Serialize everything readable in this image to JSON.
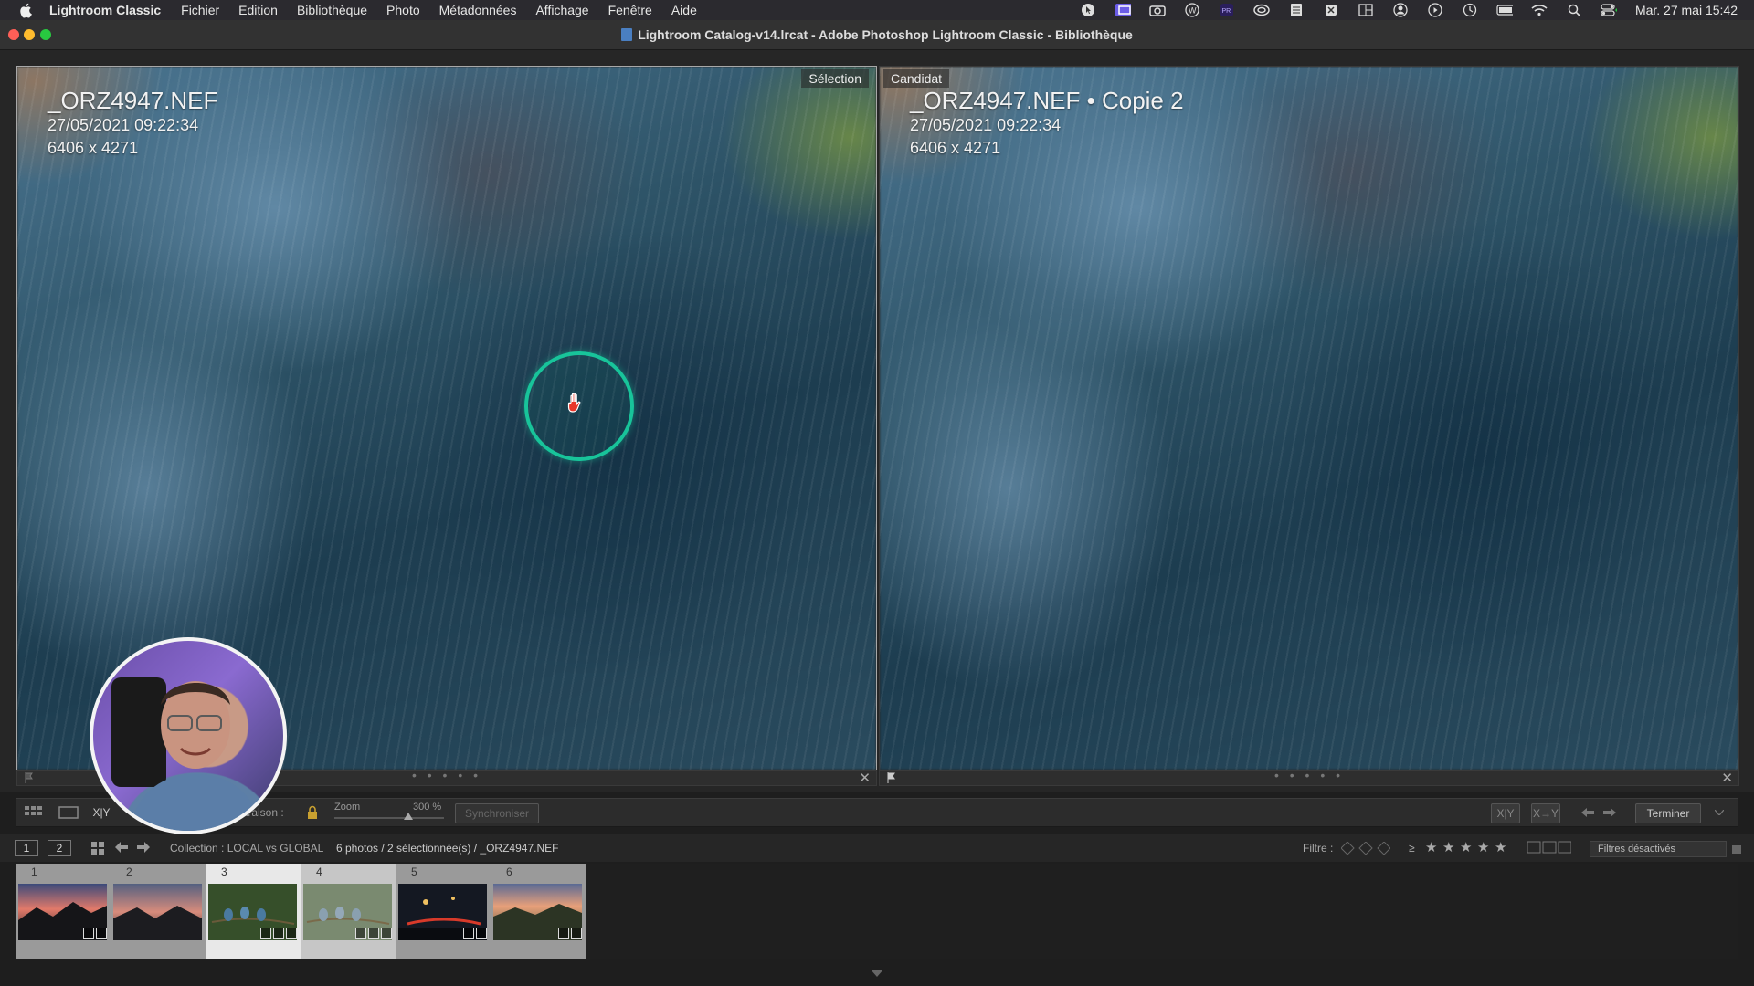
{
  "menubar": {
    "app_name": "Lightroom Classic",
    "items": [
      "Fichier",
      "Edition",
      "Bibliothèque",
      "Photo",
      "Métadonnées",
      "Affichage",
      "Fenêtre",
      "Aide"
    ],
    "clock": "Mar. 27 mai  15:42"
  },
  "window": {
    "title": "Lightroom Catalog-v14.lrcat - Adobe Photoshop Lightroom Classic - Bibliothèque"
  },
  "left_pane": {
    "label": "Sélection",
    "filename": "_ORZ4947.NEF",
    "datetime": "27/05/2021 09:22:34",
    "dimensions": "6406 x 4271"
  },
  "right_pane": {
    "label": "Candidat",
    "filename": "_ORZ4947.NEF  •  Copie 2",
    "datetime": "27/05/2021 09:22:34",
    "dimensions": "6406 x 4271"
  },
  "strip": {
    "dots": "• • • • •",
    "close": "✕"
  },
  "toolbar": {
    "compare_label": "paraison :",
    "zoom_label": "Zoom",
    "zoom_value": "300 %",
    "sync_label": "Synchroniser",
    "xy1": "X|Y",
    "xy2": "X→Y",
    "done_label": "Terminer"
  },
  "filmstrip_bar": {
    "page1": "1",
    "page2": "2",
    "collection": "Collection : LOCAL vs GLOBAL",
    "count": "6 photos / 2 sélectionnée(s) / _ORZ4947.NEF",
    "filter_label": "Filtre :",
    "rating_op": "≥",
    "filter_value": "Filtres désactivés"
  },
  "thumbnails": [
    {
      "num": "1"
    },
    {
      "num": "2"
    },
    {
      "num": "3"
    },
    {
      "num": "4"
    },
    {
      "num": "5"
    },
    {
      "num": "6"
    }
  ]
}
